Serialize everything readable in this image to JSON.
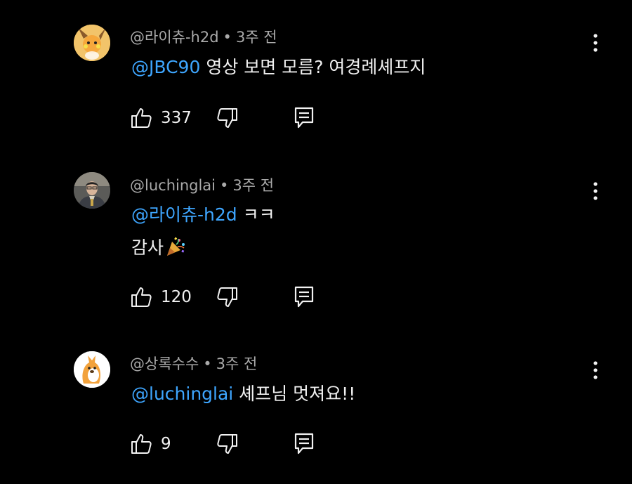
{
  "comments": [
    {
      "author": "@라이츄-h2d",
      "separator": "•",
      "time": "3주 전",
      "mention": "@JBC90",
      "text": "영상 보면 모름? 여경례셰프지",
      "likes": "337"
    },
    {
      "author": "@luchinglai",
      "separator": "•",
      "time": "3주 전",
      "mention": "@라이츄-h2d",
      "text": "ㅋㅋ",
      "line2": "감사",
      "line2_emoji": "party-popper",
      "likes": "120"
    },
    {
      "author": "@상록수수",
      "separator": "•",
      "time": "3주 전",
      "mention": "@luchinglai",
      "text": "셰프님 멋져요!!",
      "likes": "9"
    }
  ],
  "icons": {
    "like": "thumbs-up-icon",
    "dislike": "thumbs-down-icon",
    "reply": "reply-icon",
    "menu": "more-vert-icon"
  },
  "colors": {
    "background": "#000000",
    "text": "#f1f1f1",
    "meta": "#aaaaaa",
    "mention": "#3ea6ff"
  }
}
